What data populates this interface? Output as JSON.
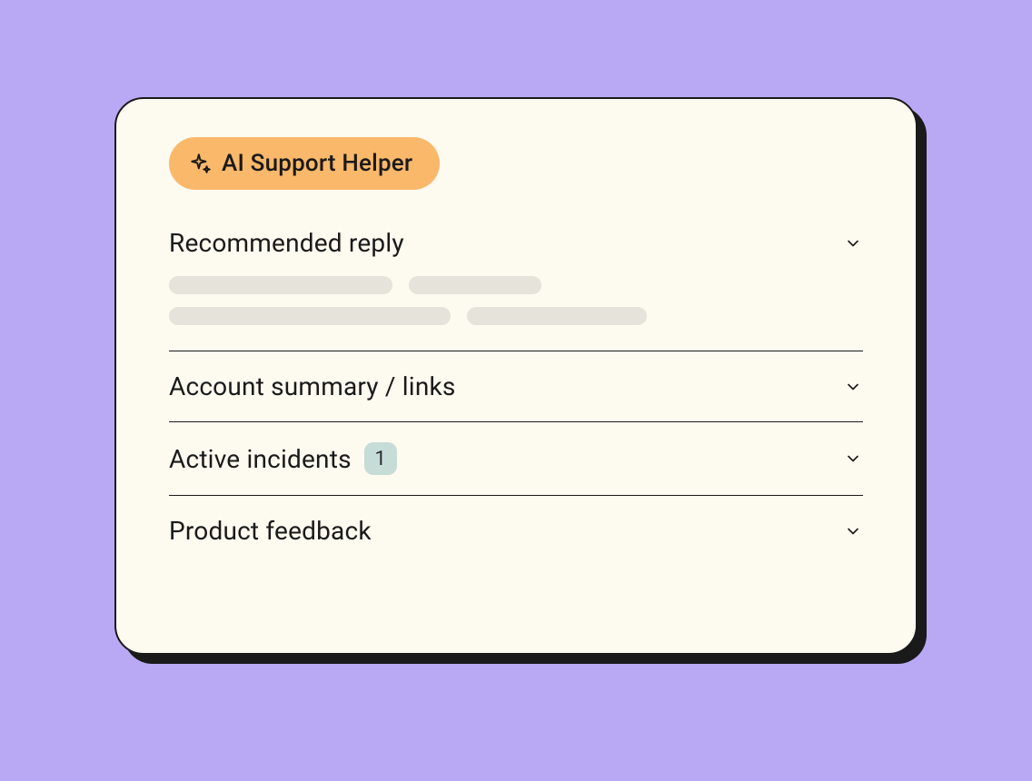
{
  "header": {
    "badge_label": "AI Support Helper"
  },
  "sections": [
    {
      "id": "recommended",
      "title": "Recommended reply",
      "expanded": true,
      "badge": null
    },
    {
      "id": "account",
      "title": "Account summary / links",
      "expanded": false,
      "badge": null
    },
    {
      "id": "incidents",
      "title": "Active incidents",
      "expanded": false,
      "badge": "1"
    },
    {
      "id": "feedback",
      "title": "Product feedback",
      "expanded": false,
      "badge": null
    }
  ],
  "colors": {
    "background": "#B9A9F5",
    "panel": "#FDFAF0",
    "badge": "#FAB86B",
    "count_badge": "#C6DCD7",
    "skeleton": "#E5E3DA",
    "text": "#1A1A1A"
  }
}
